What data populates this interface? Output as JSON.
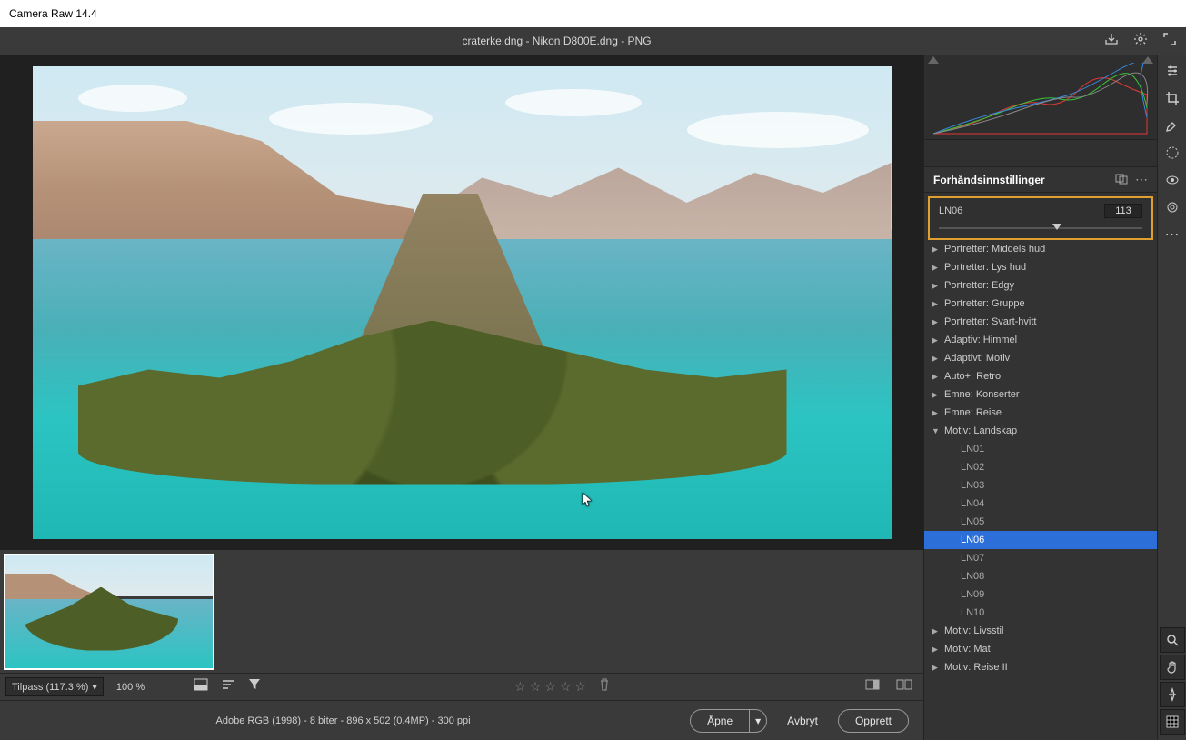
{
  "app": {
    "title": "Camera Raw 14.4"
  },
  "document": {
    "title": "craterke.dng - Nikon D800E.dng  -  PNG"
  },
  "zoom": {
    "fit_label": "Tilpass (117.3 %)",
    "hundred": "100 %"
  },
  "footer": {
    "meta": "Adobe RGB (1998) - 8 biter - 896 x 502 (0.4MP) - 300 ppi",
    "open": "Åpne",
    "cancel": "Avbryt",
    "create": "Opprett"
  },
  "panel": {
    "title": "Forhåndsinnstillinger",
    "preset_name": "LN06",
    "preset_value": "113"
  },
  "groups": [
    {
      "label": "Portretter: Middels hud",
      "open": false
    },
    {
      "label": "Portretter: Lys hud",
      "open": false
    },
    {
      "label": "Portretter: Edgy",
      "open": false
    },
    {
      "label": "Portretter: Gruppe",
      "open": false
    },
    {
      "label": "Portretter: Svart-hvitt",
      "open": false
    },
    {
      "label": "Adaptiv: Himmel",
      "open": false
    },
    {
      "label": "Adaptivt: Motiv",
      "open": false
    },
    {
      "label": "Auto+: Retro",
      "open": false
    },
    {
      "label": "Emne: Konserter",
      "open": false
    },
    {
      "label": "Emne: Reise",
      "open": false
    },
    {
      "label": "Motiv: Landskap",
      "open": true,
      "items": [
        {
          "label": "LN01"
        },
        {
          "label": "LN02"
        },
        {
          "label": "LN03"
        },
        {
          "label": "LN04"
        },
        {
          "label": "LN05"
        },
        {
          "label": "LN06",
          "selected": true
        },
        {
          "label": "LN07"
        },
        {
          "label": "LN08"
        },
        {
          "label": "LN09"
        },
        {
          "label": "LN10"
        }
      ]
    },
    {
      "label": "Motiv: Livsstil",
      "open": false
    },
    {
      "label": "Motiv: Mat",
      "open": false
    },
    {
      "label": "Motiv: Reise II",
      "open": false
    }
  ],
  "tools": {
    "edit": "edit",
    "crop": "crop",
    "heal": "heal",
    "mask": "mask",
    "redeye": "redeye",
    "presets": "presets",
    "more": "more",
    "zoom": "zoom",
    "hand": "hand",
    "sampler": "sampler",
    "grid": "grid"
  }
}
